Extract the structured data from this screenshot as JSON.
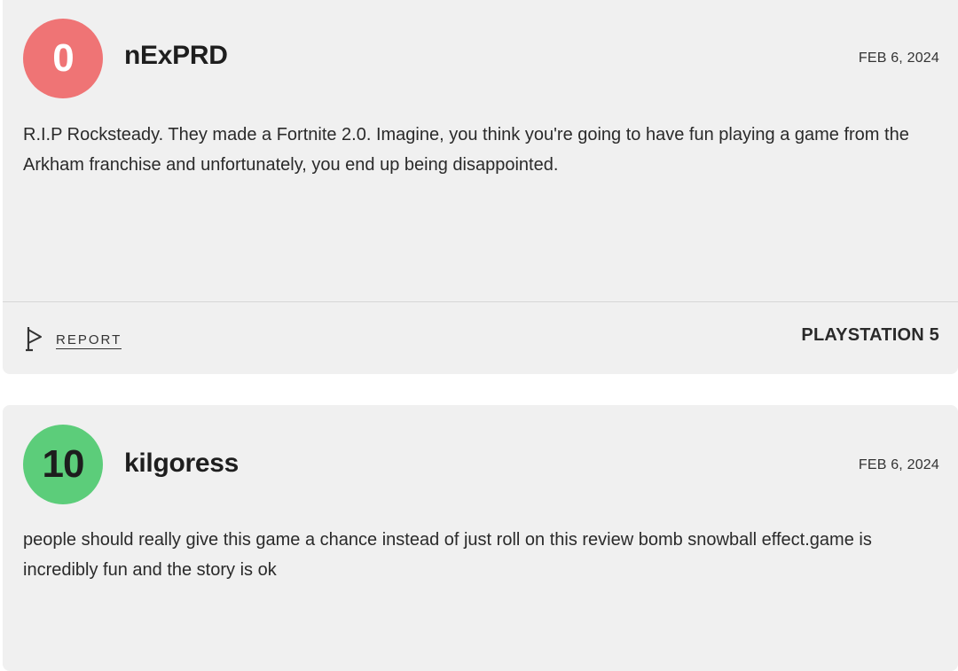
{
  "reviews": [
    {
      "score": "0",
      "sentiment": "negative",
      "score_color": "#ef7475",
      "username": "nExPRD",
      "date": "FEB 6, 2024",
      "text": "R.I.P Rocksteady. They made a Fortnite 2.0. Imagine, you think you're going to have fun playing a game from the Arkham franchise and unfortunately, you end up being disappointed.",
      "report_label": "REPORT",
      "report_icon": "flag-icon",
      "platform": "PLAYSTATION 5"
    },
    {
      "score": "10",
      "sentiment": "positive",
      "score_color": "#5ccd7a",
      "username": "kilgoress",
      "date": "FEB 6, 2024",
      "text": "people should really give this game a chance instead of just roll on this review bomb snowball effect.game is incredibly fun and the story is ok"
    }
  ]
}
